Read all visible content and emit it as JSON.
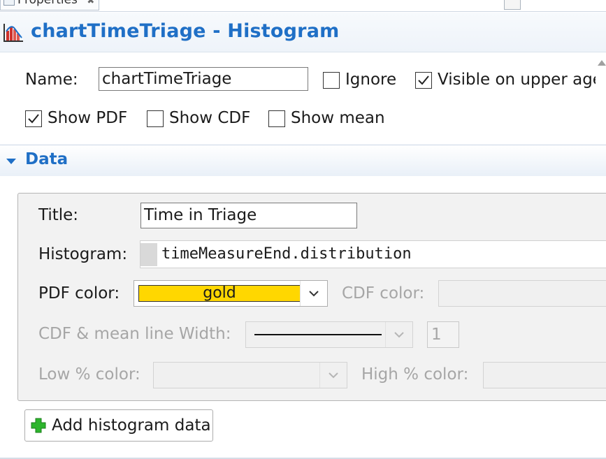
{
  "tab": {
    "title": "Properties",
    "close_symbol": "✖"
  },
  "header": {
    "title": "chartTimeTriage - Histogram",
    "icon": "histogram-chart-icon"
  },
  "general": {
    "name_label": "Name:",
    "name_value": "chartTimeTriage",
    "ignore_label": "Ignore",
    "ignore_checked": false,
    "visible_label": "Visible on upper agent",
    "visible_checked": true,
    "show_pdf_label": "Show PDF",
    "show_pdf_checked": true,
    "show_cdf_label": "Show CDF",
    "show_cdf_checked": false,
    "show_mean_label": "Show mean",
    "show_mean_checked": false
  },
  "data_section": {
    "title": "Data",
    "expanded": true,
    "title_label": "Title:",
    "title_value": "Time in Triage",
    "histogram_label": "Histogram:",
    "histogram_value": "timeMeasureEnd.distribution",
    "pdf_color_label": "PDF color:",
    "pdf_color_value": "gold",
    "pdf_color_hex": "#FFD700",
    "cdf_color_label": "CDF color:",
    "cdf_mean_width_label": "CDF & mean line Width:",
    "cdf_mean_width_value": "1",
    "low_color_label": "Low % color:",
    "high_color_label": "High % color:",
    "add_button_label": "Add histogram data"
  },
  "colors": {
    "accent": "#1F6FC6",
    "disabled_text": "#A6A6A6",
    "add_icon": "#2DB52D"
  }
}
